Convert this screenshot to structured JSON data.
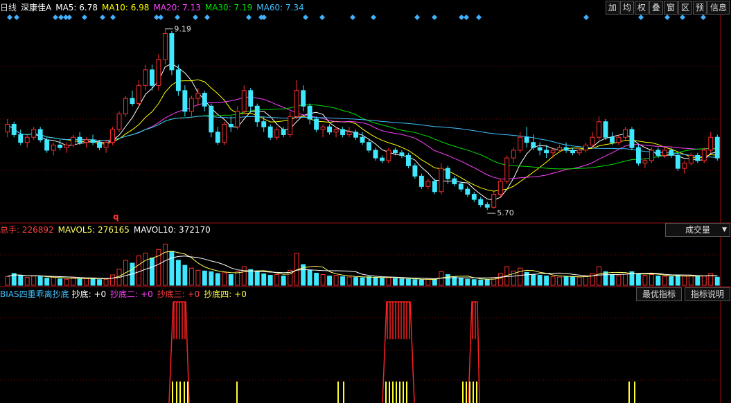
{
  "stock": {
    "period": "日线",
    "name": "深康佳A"
  },
  "ma_legend": [
    {
      "label": "MA5: 6.78",
      "color": "#ffffff"
    },
    {
      "label": "MA10: 6.98",
      "color": "#ffff00"
    },
    {
      "label": "MA20: 7.13",
      "color": "#ff40ff"
    },
    {
      "label": "MA30: 7.19",
      "color": "#00e000"
    },
    {
      "label": "MA60: 7.34",
      "color": "#40c0ff"
    }
  ],
  "toolbar": [
    "加",
    "均",
    "权",
    "叠",
    "窗",
    "区",
    "预",
    "信息"
  ],
  "volume": {
    "total": "总手: 226892",
    "mavol5": "MAVOL5: 276165",
    "mavol10": "MAVOL10: 372170",
    "selector": "成交量"
  },
  "indicator": {
    "name": "BIAS四重乖离抄底",
    "line1": "抄底: +0",
    "line2": "抄底二: +0",
    "line3": "抄底三: +0",
    "line4": "抄底四: +0",
    "btn_best": "最优指标",
    "btn_explain": "指标说明"
  },
  "annotations": {
    "high": "9.19",
    "low": "5.70",
    "marker": "q"
  },
  "colors": {
    "up": "#ff3030",
    "down": "#40e8ff",
    "grid": "#8b0000"
  },
  "chart_data": [
    {
      "type": "candlestick",
      "title": "深康佳A 日线",
      "ylim": [
        5.5,
        9.4
      ],
      "high_label": 9.19,
      "low_label": 5.7,
      "ohlc": [
        [
          7.2,
          7.45,
          7.1,
          7.35
        ],
        [
          7.35,
          7.4,
          7.1,
          7.15
        ],
        [
          7.15,
          7.25,
          6.95,
          7.0
        ],
        [
          7.0,
          7.15,
          6.9,
          7.1
        ],
        [
          7.1,
          7.3,
          7.05,
          7.25
        ],
        [
          7.25,
          7.3,
          7.0,
          7.05
        ],
        [
          7.05,
          7.1,
          6.8,
          6.85
        ],
        [
          6.85,
          7.0,
          6.75,
          6.95
        ],
        [
          6.95,
          7.05,
          6.85,
          6.9
        ],
        [
          6.9,
          7.0,
          6.8,
          6.95
        ],
        [
          6.95,
          7.15,
          6.9,
          7.1
        ],
        [
          7.1,
          7.2,
          6.95,
          7.0
        ],
        [
          7.0,
          7.1,
          6.9,
          7.05
        ],
        [
          7.05,
          7.15,
          6.95,
          7.0
        ],
        [
          7.0,
          7.05,
          6.85,
          6.9
        ],
        [
          6.9,
          7.05,
          6.8,
          7.0
        ],
        [
          7.0,
          7.3,
          6.95,
          7.25
        ],
        [
          7.25,
          7.6,
          7.2,
          7.55
        ],
        [
          7.55,
          7.9,
          7.5,
          7.85
        ],
        [
          7.85,
          8.0,
          7.7,
          7.75
        ],
        [
          7.75,
          8.2,
          7.7,
          8.1
        ],
        [
          8.1,
          8.5,
          8.0,
          8.4
        ],
        [
          8.4,
          8.5,
          8.0,
          8.1
        ],
        [
          8.1,
          8.7,
          8.0,
          8.6
        ],
        [
          8.6,
          9.19,
          8.5,
          9.1
        ],
        [
          9.1,
          9.15,
          8.3,
          8.4
        ],
        [
          8.4,
          8.5,
          7.9,
          8.0
        ],
        [
          8.0,
          8.1,
          7.5,
          7.6
        ],
        [
          7.6,
          7.9,
          7.5,
          7.85
        ],
        [
          7.85,
          8.05,
          7.7,
          7.95
        ],
        [
          7.95,
          8.0,
          7.6,
          7.7
        ],
        [
          7.7,
          7.75,
          7.1,
          7.2
        ],
        [
          7.2,
          7.3,
          6.95,
          7.0
        ],
        [
          7.0,
          7.4,
          6.95,
          7.35
        ],
        [
          7.35,
          7.5,
          7.2,
          7.3
        ],
        [
          7.3,
          7.7,
          7.25,
          7.6
        ],
        [
          7.6,
          8.1,
          7.55,
          8.0
        ],
        [
          8.0,
          8.05,
          7.6,
          7.7
        ],
        [
          7.7,
          7.75,
          7.3,
          7.4
        ],
        [
          7.4,
          7.5,
          7.2,
          7.3
        ],
        [
          7.3,
          7.35,
          7.05,
          7.1
        ],
        [
          7.1,
          7.3,
          7.05,
          7.25
        ],
        [
          7.25,
          7.3,
          7.1,
          7.15
        ],
        [
          7.15,
          7.6,
          7.1,
          7.5
        ],
        [
          7.5,
          8.2,
          7.45,
          8.0
        ],
        [
          8.0,
          8.1,
          7.6,
          7.7
        ],
        [
          7.7,
          7.75,
          7.35,
          7.45
        ],
        [
          7.45,
          7.5,
          7.2,
          7.25
        ],
        [
          7.25,
          7.35,
          7.1,
          7.3
        ],
        [
          7.3,
          7.35,
          7.15,
          7.2
        ],
        [
          7.2,
          7.3,
          7.1,
          7.25
        ],
        [
          7.25,
          7.3,
          7.1,
          7.15
        ],
        [
          7.15,
          7.3,
          7.1,
          7.2
        ],
        [
          7.2,
          7.25,
          7.05,
          7.1
        ],
        [
          7.1,
          7.2,
          6.95,
          7.0
        ],
        [
          7.0,
          7.05,
          6.8,
          6.85
        ],
        [
          6.85,
          6.9,
          6.65,
          6.7
        ],
        [
          6.7,
          6.75,
          6.6,
          6.65
        ],
        [
          6.65,
          6.9,
          6.6,
          6.85
        ],
        [
          6.85,
          6.9,
          6.75,
          6.8
        ],
        [
          6.8,
          6.85,
          6.7,
          6.75
        ],
        [
          6.75,
          6.8,
          6.5,
          6.55
        ],
        [
          6.55,
          6.6,
          6.3,
          6.35
        ],
        [
          6.35,
          6.4,
          6.1,
          6.15
        ],
        [
          6.15,
          6.3,
          6.1,
          6.25
        ],
        [
          6.25,
          6.3,
          6.0,
          6.05
        ],
        [
          6.05,
          6.6,
          6.0,
          6.5
        ],
        [
          6.5,
          6.55,
          6.2,
          6.3
        ],
        [
          6.3,
          6.35,
          6.15,
          6.2
        ],
        [
          6.2,
          6.25,
          6.05,
          6.1
        ],
        [
          6.1,
          6.15,
          5.95,
          6.0
        ],
        [
          6.0,
          6.05,
          5.85,
          5.9
        ],
        [
          5.9,
          5.95,
          5.75,
          5.8
        ],
        [
          5.8,
          5.85,
          5.7,
          5.75
        ],
        [
          5.75,
          6.05,
          5.72,
          6.0
        ],
        [
          6.0,
          6.3,
          5.95,
          6.25
        ],
        [
          6.25,
          6.75,
          6.2,
          6.7
        ],
        [
          6.7,
          6.9,
          6.6,
          6.85
        ],
        [
          6.85,
          7.2,
          6.8,
          7.1
        ],
        [
          7.1,
          7.3,
          6.9,
          7.0
        ],
        [
          7.0,
          7.15,
          6.85,
          6.9
        ],
        [
          6.9,
          7.0,
          6.75,
          6.85
        ],
        [
          6.85,
          6.95,
          6.7,
          6.8
        ],
        [
          6.8,
          6.9,
          6.7,
          6.85
        ],
        [
          6.85,
          6.95,
          6.8,
          6.9
        ],
        [
          6.9,
          7.0,
          6.8,
          6.85
        ],
        [
          6.85,
          6.9,
          6.75,
          6.8
        ],
        [
          6.8,
          6.9,
          6.75,
          6.85
        ],
        [
          6.85,
          7.0,
          6.8,
          6.95
        ],
        [
          6.95,
          7.2,
          6.9,
          7.1
        ],
        [
          7.1,
          7.5,
          7.05,
          7.4
        ],
        [
          7.4,
          7.45,
          7.05,
          7.1
        ],
        [
          7.1,
          7.2,
          6.95,
          7.0
        ],
        [
          7.0,
          7.15,
          6.95,
          7.1
        ],
        [
          7.1,
          7.3,
          7.05,
          7.25
        ],
        [
          7.25,
          7.3,
          6.85,
          6.9
        ],
        [
          6.9,
          6.95,
          6.55,
          6.6
        ],
        [
          6.6,
          6.7,
          6.5,
          6.65
        ],
        [
          6.65,
          6.9,
          6.6,
          6.85
        ],
        [
          6.85,
          6.9,
          6.7,
          6.75
        ],
        [
          6.75,
          6.9,
          6.7,
          6.85
        ],
        [
          6.85,
          6.9,
          6.7,
          6.75
        ],
        [
          6.75,
          6.8,
          6.45,
          6.5
        ],
        [
          6.5,
          6.65,
          6.4,
          6.6
        ],
        [
          6.6,
          6.8,
          6.55,
          6.75
        ],
        [
          6.75,
          6.8,
          6.6,
          6.65
        ],
        [
          6.65,
          6.9,
          6.6,
          6.85
        ],
        [
          6.85,
          7.2,
          6.8,
          7.1
        ],
        [
          7.1,
          7.15,
          6.65,
          6.7
        ]
      ]
    },
    {
      "type": "bar",
      "title": "成交量",
      "ylim": [
        0,
        1200000
      ],
      "values": [
        250000,
        330000,
        280000,
        220000,
        260000,
        240000,
        200000,
        220000,
        180000,
        170000,
        210000,
        190000,
        200000,
        180000,
        160000,
        170000,
        290000,
        450000,
        700000,
        620000,
        820000,
        900000,
        760000,
        1000000,
        1150000,
        950000,
        700000,
        560000,
        480000,
        420000,
        400000,
        380000,
        330000,
        350000,
        300000,
        380000,
        520000,
        440000,
        380000,
        320000,
        280000,
        300000,
        260000,
        420000,
        900000,
        580000,
        420000,
        340000,
        300000,
        260000,
        280000,
        240000,
        230000,
        220000,
        210000,
        240000,
        220000,
        200000,
        230000,
        190000,
        180000,
        170000,
        160000,
        150000,
        170000,
        160000,
        380000,
        300000,
        230000,
        200000,
        170000,
        160000,
        150000,
        160000,
        220000,
        330000,
        520000,
        400000,
        480000,
        360000,
        300000,
        280000,
        260000,
        240000,
        230000,
        250000,
        240000,
        230000,
        260000,
        330000,
        520000,
        380000,
        300000,
        270000,
        310000,
        380000,
        330000,
        280000,
        300000,
        260000,
        250000,
        240000,
        280000,
        260000,
        270000,
        240000,
        260000,
        330000,
        226892
      ]
    }
  ]
}
